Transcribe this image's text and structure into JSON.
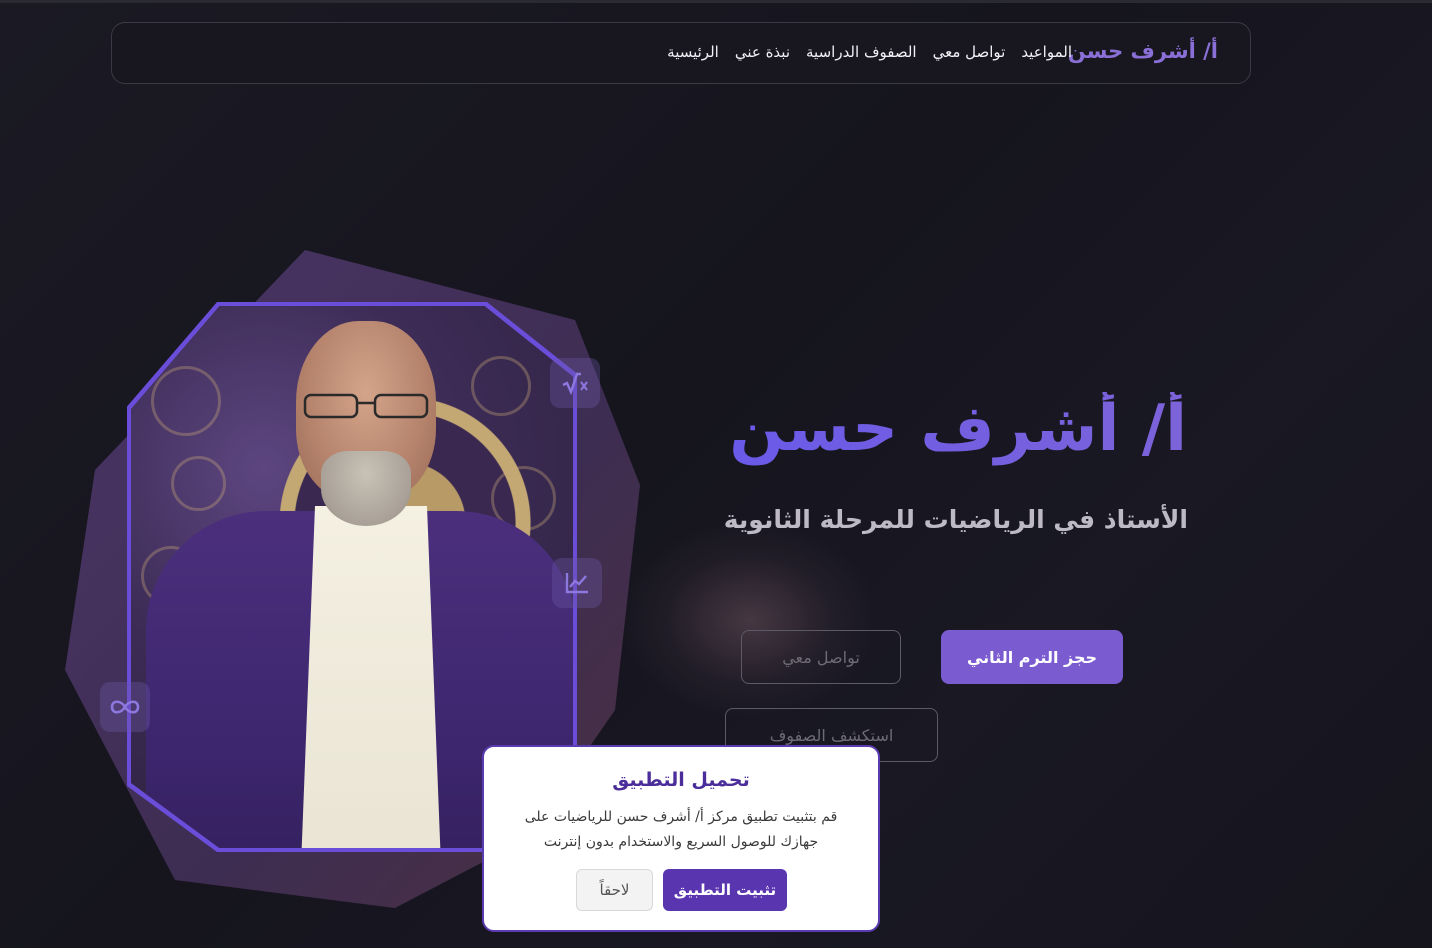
{
  "navbar": {
    "brand": "أ/ أشرف حسن",
    "links": [
      "الرئيسية",
      "نبذة عني",
      "الصفوف الدراسية",
      "تواصل معي",
      "المواعيد"
    ]
  },
  "hero": {
    "title": "أ/ أشرف حسن",
    "subtitle": "الأستاذ في الرياضيات للمرحلة الثانوية",
    "primary_button": "حجز الترم الثاني",
    "contact_button": "تواصل معي",
    "explore_button": "استكشف الصفوف",
    "badges": [
      "square-root-icon",
      "chart-line-icon",
      "infinity-icon"
    ]
  },
  "install_dialog": {
    "title": "تحميل التطبيق",
    "message": "قم بتثبيت تطبيق مركز أ/ أشرف حسن للرياضيات على جهازك للوصول السريع والاستخدام بدون إنترنت",
    "install_button": "تثبيت التطبيق",
    "later_button": "لاحقاً"
  },
  "colors": {
    "accent": "#7b5bd0",
    "brand_text": "#8a6fd6",
    "background": "#16151e",
    "dialog_border": "#5b3bb0"
  }
}
